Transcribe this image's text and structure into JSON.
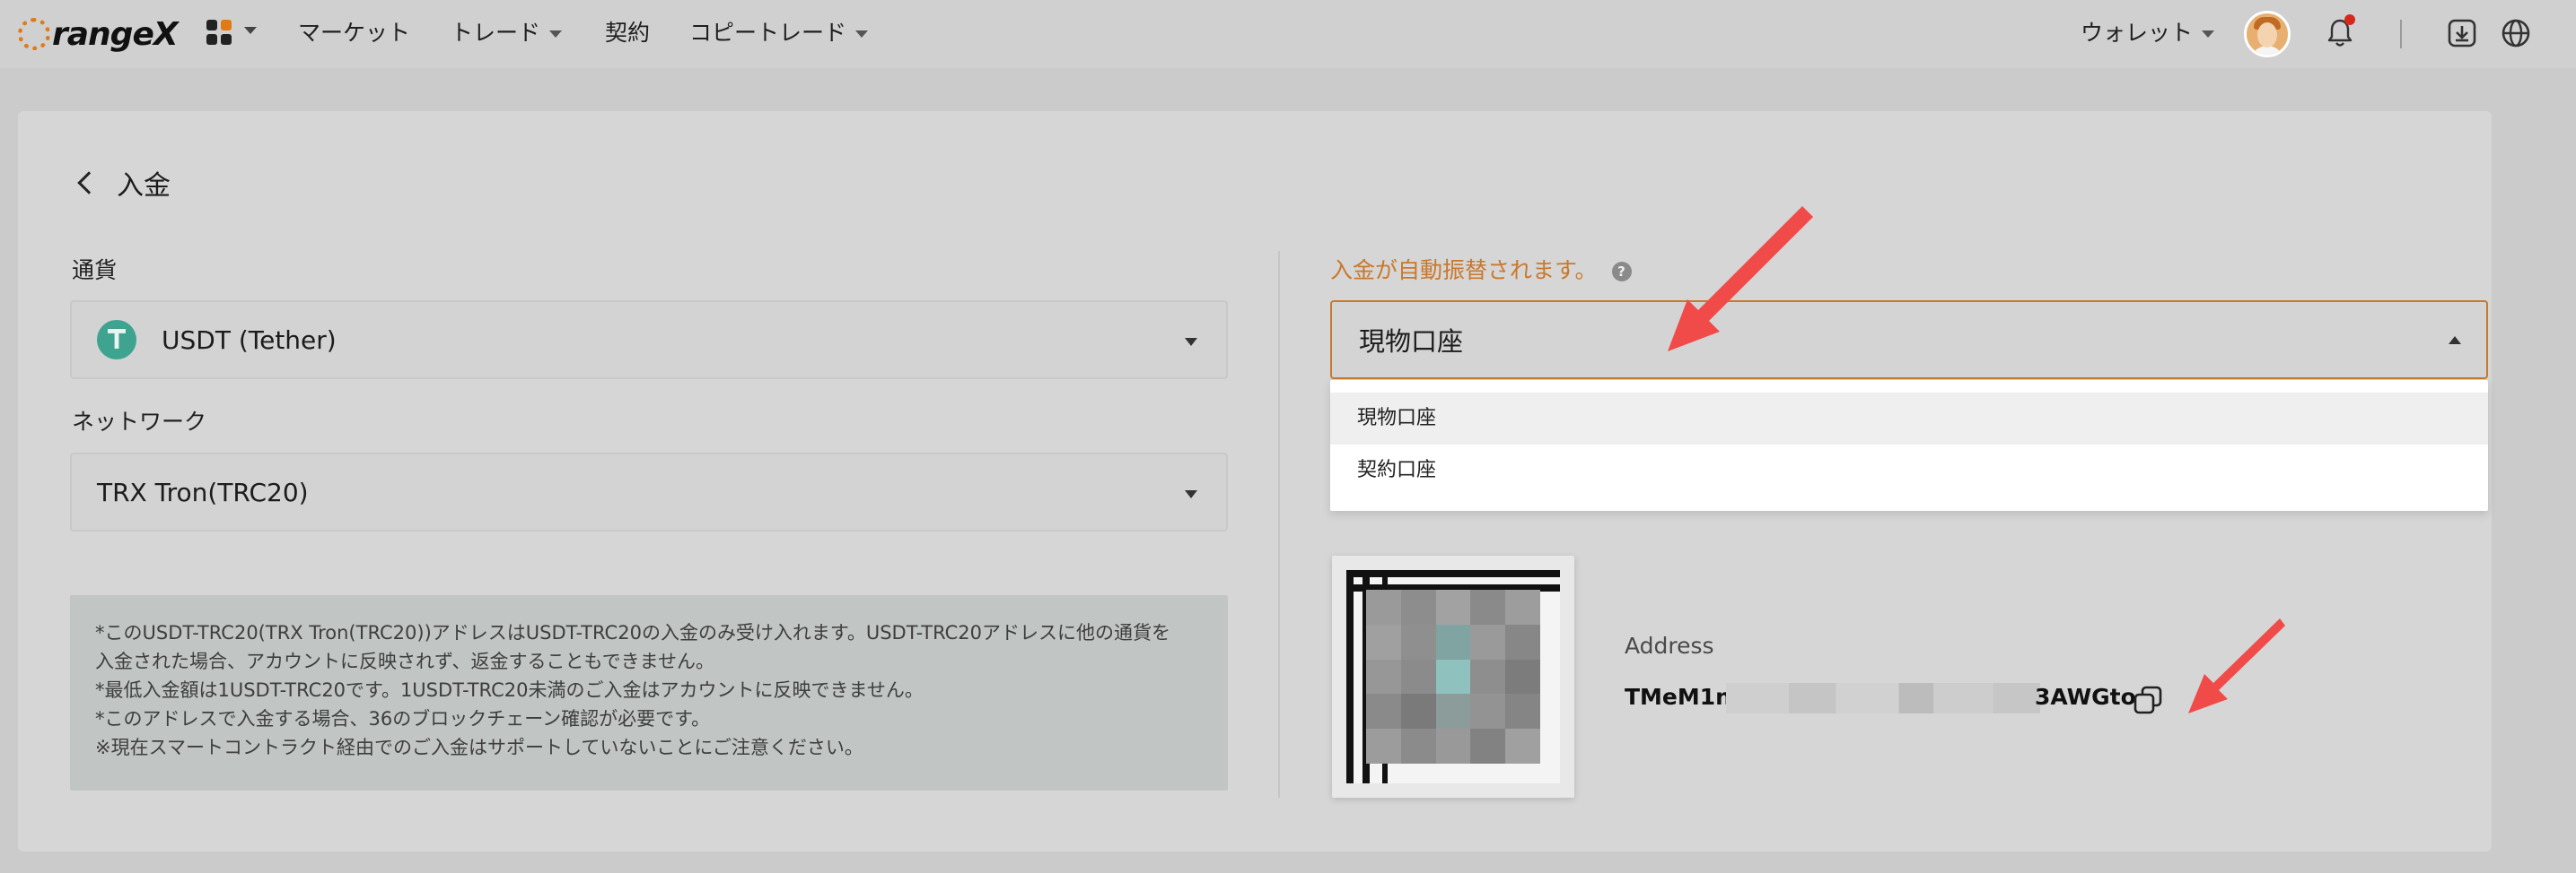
{
  "brand": {
    "logo_text": "rangeX",
    "logo_alt": "OrangeX"
  },
  "nav": {
    "items": [
      {
        "label": "マーケット"
      },
      {
        "label": "トレード"
      },
      {
        "label": "契約"
      },
      {
        "label": "コピートレード"
      }
    ],
    "wallet_label": "ウォレット"
  },
  "page": {
    "title": "入金"
  },
  "currency": {
    "label": "通貨",
    "selected": "USDT (Tether)"
  },
  "network": {
    "label": "ネットワーク",
    "selected": "TRX Tron(TRC20)"
  },
  "notice": {
    "lines": [
      "*このUSDT-TRC20(TRX Tron(TRC20))アドレスはUSDT-TRC20の入金のみ受け入れます。USDT-TRC20アドレスに他の通貨を",
      "入金された場合、アカウントに反映されず、返金することもできません。",
      "*最低入金額は1USDT-TRC20です。1USDT-TRC20未満のご入金はアカウントに反映できません。",
      "*このアドレスで入金する場合、36のブロックチェーン確認が必要です。",
      "※現在スマートコントラクト経由でのご入金はサポートしていないことにご注意ください。"
    ]
  },
  "auto_transfer": {
    "label": "入金が自動振替されます。",
    "help": "?",
    "selected": "現物口座",
    "options": [
      "現物口座",
      "契約口座"
    ]
  },
  "deposit_address": {
    "label": "Address",
    "prefix": "TMeM1n",
    "suffix": "3AWGto"
  },
  "colors": {
    "accent": "#e07a18",
    "auto_label": "#c9782c",
    "arrow": "#f04b48"
  }
}
